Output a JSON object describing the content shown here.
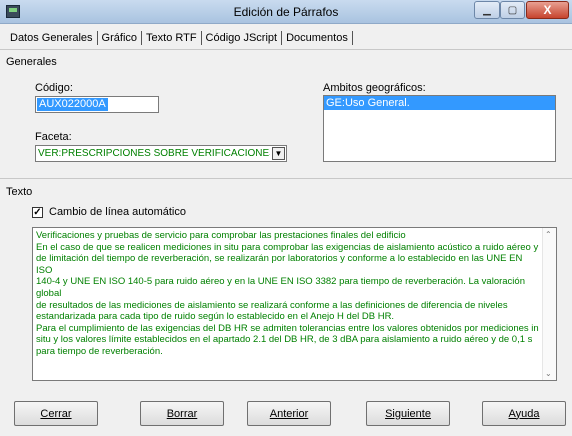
{
  "window": {
    "title": "Edición de Párrafos",
    "min_glyph": "▁",
    "max_glyph": "▢",
    "close_glyph": "X"
  },
  "tabs": [
    "Datos Generales",
    "Gráfico",
    "Texto RTF",
    "Código JScript",
    "Documentos"
  ],
  "generales": {
    "section_title": "Generales",
    "codigo_label": "Código:",
    "codigo_value": "AUX022000A",
    "faceta_label": "Faceta:",
    "faceta_value": "VER:PRESCRIPCIONES SOBRE VERIFICACIONES EN EL EDI",
    "ambitos_label": "Ambitos geográficos:",
    "ambitos_items": [
      "GE:Uso General."
    ]
  },
  "texto": {
    "section_title": "Texto",
    "checkbox_label": "Cambio de línea automático",
    "checkbox_checked": true,
    "body_lines": [
      "Verificaciones y pruebas de servicio para comprobar las prestaciones finales del edificio",
      "En el caso de que se realicen mediciones in situ para comprobar las exigencias de aislamiento acústico a ruido aéreo y",
      "de limitación del tiempo de reverberación, se realizarán por laboratorios y conforme a lo establecido en las UNE EN ISO",
      "140-4 y UNE EN ISO 140-5 para ruido aéreo y en la UNE EN ISO 3382 para tiempo de reverberación. La valoración global",
      "de resultados de las mediciones de aislamiento se realizará conforme a las definiciones de diferencia de niveles",
      "estandarizada para cada tipo de ruido según lo establecido en el Anejo H del DB HR.",
      "Para el cumplimiento de las exigencias del DB HR se admiten tolerancias entre los valores obtenidos por mediciones in",
      "situ y los valores límite establecidos en el apartado 2.1 del DB HR, de 3 dBA para aislamiento a ruido aéreo y de 0,1 s",
      "para tiempo de reverberación."
    ]
  },
  "buttons": {
    "cerrar": "Cerrar",
    "borrar": "Borrar",
    "anterior": "Anterior",
    "siguiente": "Siguiente",
    "ayuda": "Ayuda"
  },
  "colors": {
    "text_green": "#008000",
    "selection_blue": "#3399ff"
  }
}
